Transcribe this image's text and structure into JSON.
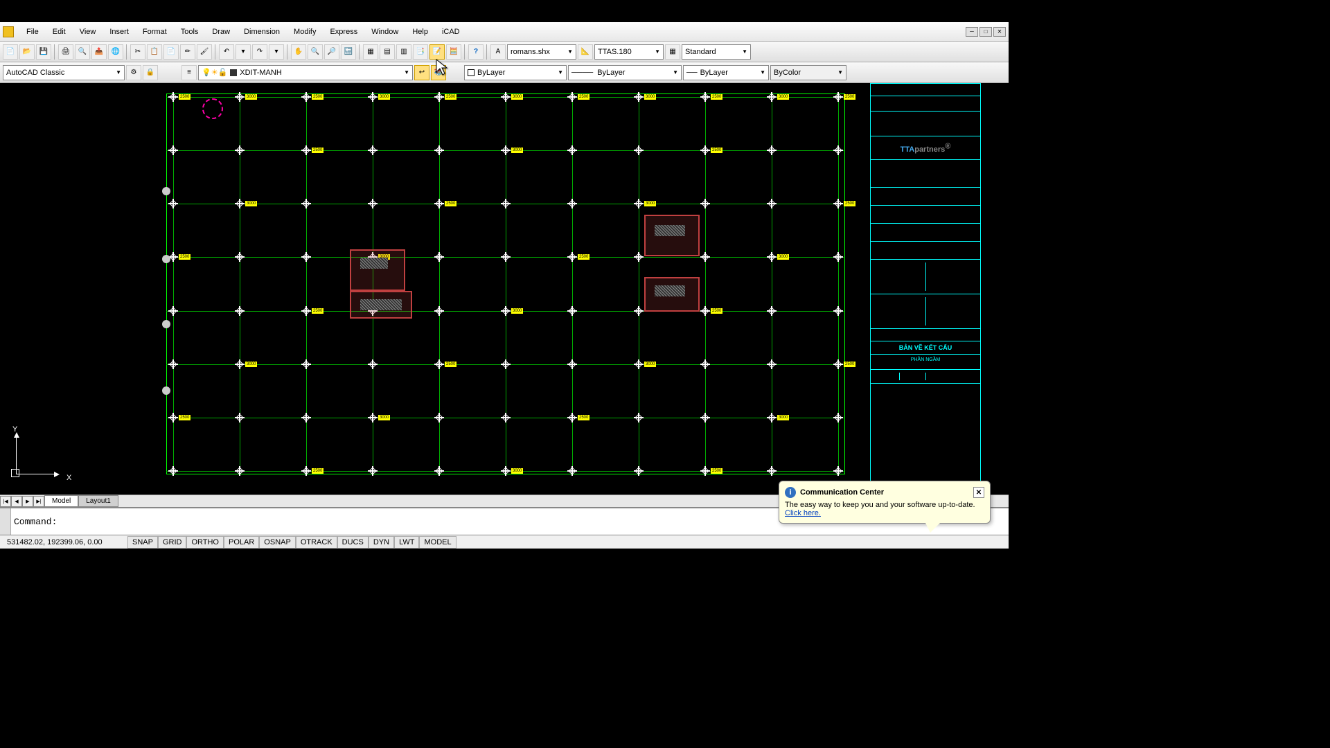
{
  "menus": [
    "File",
    "Edit",
    "View",
    "Insert",
    "Format",
    "Tools",
    "Draw",
    "Dimension",
    "Modify",
    "Express",
    "Window",
    "Help",
    "iCAD"
  ],
  "workspace": "AutoCAD Classic",
  "layer_name": "XDIT-MANH",
  "text_style": "romans.shx",
  "dim_style": "TTAS.180",
  "table_style": "Standard",
  "linetype1": "ByLayer",
  "linetype2": "ByLayer",
  "linetype3": "ByLayer",
  "color_control": "ByColor",
  "tabs": {
    "model": "Model",
    "layout1": "Layout1"
  },
  "command_prompt": "Command:",
  "coords": "531482.02, 192399.06, 0.00",
  "status_toggles": [
    "SNAP",
    "GRID",
    "ORTHO",
    "POLAR",
    "OSNAP",
    "OTRACK",
    "DUCS",
    "DYN",
    "LWT",
    "MODEL"
  ],
  "popup": {
    "title": "Communication Center",
    "body": "The easy way to keep you and your software up-to-date.",
    "link": "Click here."
  },
  "title_block": {
    "logo_l": "TTA",
    "logo_r": "partners",
    "logo_reg": "®",
    "main_title": "BẢN VẼ KẾT CẤU",
    "subtitle": "PHẦN NGẦM"
  },
  "ucs": {
    "x": "X",
    "y": "Y"
  }
}
